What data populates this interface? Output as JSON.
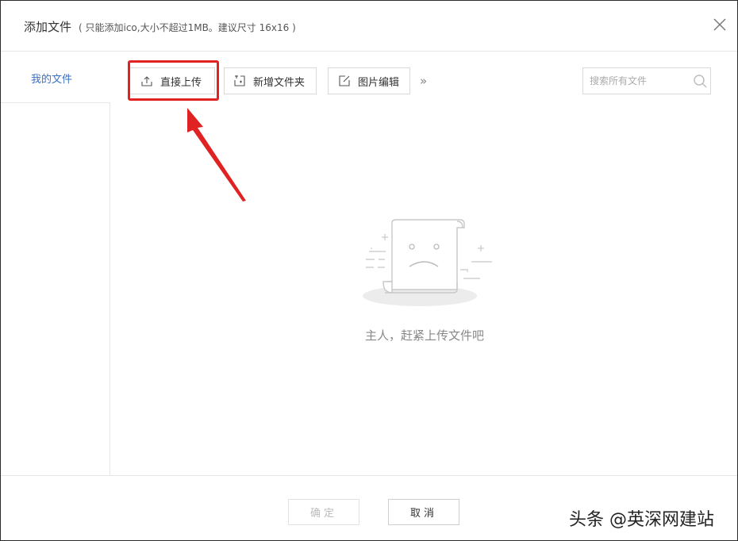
{
  "dialog": {
    "title": "添加文件",
    "subtitle": "( 只能添加ico,大小不超过1MB。建议尺寸 16x16 )",
    "close_icon": "close-icon"
  },
  "sidebar": {
    "items": [
      {
        "label": "我的文件",
        "active": true
      }
    ]
  },
  "toolbar": {
    "upload_label": "直接上传",
    "upload_icon": "upload-icon",
    "new_folder_label": "新增文件夹",
    "new_folder_icon": "new-folder-icon",
    "edit_image_label": "图片编辑",
    "edit_image_icon": "edit-icon",
    "more_label": "»",
    "more_icon": "double-chevron-right-icon"
  },
  "search": {
    "placeholder": "搜索所有文件",
    "value": "",
    "icon": "search-icon"
  },
  "empty_state": {
    "icon": "empty-document-icon",
    "message": "主人，赶紧上传文件吧"
  },
  "footer": {
    "confirm_label": "确定",
    "cancel_label": "取消",
    "confirm_enabled": false
  },
  "watermark": {
    "text": "头条 @英深网建站"
  },
  "colors": {
    "link_blue": "#3b6fc2",
    "highlight_red": "#e02222",
    "border_gray": "#d9d9d9",
    "muted_text": "#888888"
  }
}
